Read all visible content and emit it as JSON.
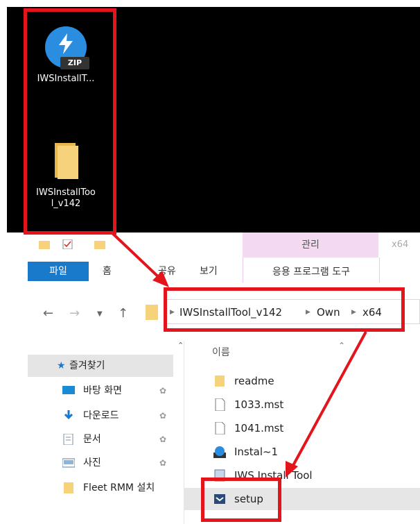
{
  "desktop": {
    "zip_icon": {
      "badge": "ZIP",
      "label": "IWSInstallT..."
    },
    "folder_icon": {
      "label_line1": "IWSInstallToo",
      "label_line2": "l_v142"
    }
  },
  "explorer": {
    "title_x64": "x64",
    "manage_tab": "관리",
    "ribbon": {
      "file": "파일",
      "home": "홈",
      "share": "공유",
      "view": "보기",
      "app_tools": "응용 프로그램 도구"
    },
    "address": {
      "crumbs": [
        "IWSInstallTool_v142",
        "Own",
        "x64"
      ]
    },
    "nav": {
      "quick_access": "즐겨찾기",
      "items": [
        {
          "label": "바탕 화면",
          "icon": "desktop-icon"
        },
        {
          "label": "다운로드",
          "icon": "download-icon"
        },
        {
          "label": "문서",
          "icon": "document-icon"
        },
        {
          "label": "사진",
          "icon": "picture-icon"
        },
        {
          "label": "Fleet RMM 설치",
          "icon": "folder-icon"
        }
      ]
    },
    "content": {
      "column_name": "이름",
      "files": [
        {
          "name": "readme",
          "icon": "folder-icon"
        },
        {
          "name": "1033.mst",
          "icon": "file-icon"
        },
        {
          "name": "1041.mst",
          "icon": "file-icon"
        },
        {
          "name": "Instal~1",
          "icon": "installer-icon"
        },
        {
          "name": "IWS Install Tool",
          "icon": "app-icon"
        },
        {
          "name": "setup",
          "icon": "setup-icon"
        }
      ]
    }
  },
  "colors": {
    "highlight": "#e3141b",
    "file_tab": "#1979ca",
    "manage_tab": "#f3d9f2",
    "desktop": "#000000"
  }
}
